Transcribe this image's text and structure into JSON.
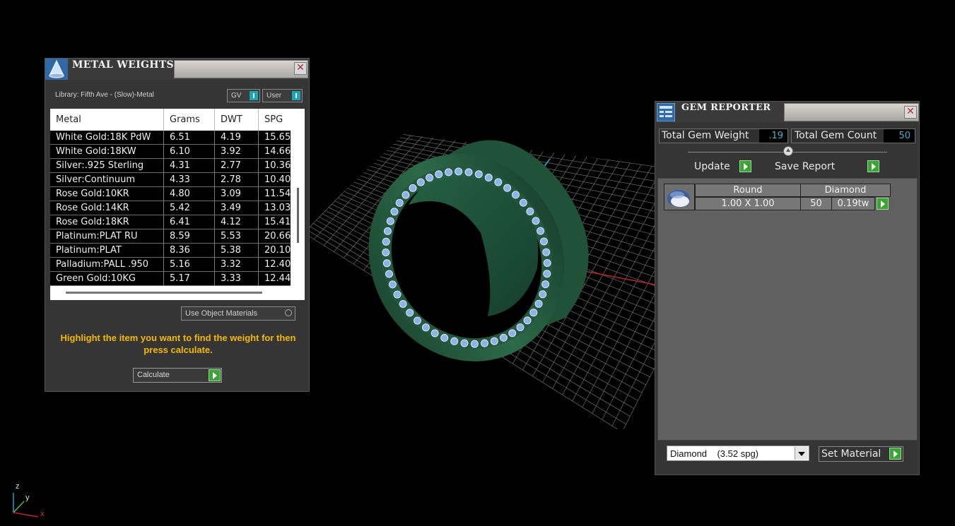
{
  "metal_weights": {
    "title": "METAL WEIGHTS",
    "library_label": "Library: Fifth Ave - (Slow)-Metal",
    "toggle_gv": "GV",
    "toggle_user": "User",
    "columns": [
      "Metal",
      "Grams",
      "DWT",
      "SPG"
    ],
    "rows": [
      [
        "White Gold:18K PdW",
        "6.51",
        "4.19",
        "15.65"
      ],
      [
        "White Gold:18KW",
        "6.10",
        "3.92",
        "14.66"
      ],
      [
        "Silver:.925 Sterling",
        "4.31",
        "2.77",
        "10.36"
      ],
      [
        "Silver:Continuum",
        "4.33",
        "2.78",
        "10.40"
      ],
      [
        "Rose Gold:10KR",
        "4.80",
        "3.09",
        "11.54"
      ],
      [
        "Rose Gold:14KR",
        "5.42",
        "3.49",
        "13.03"
      ],
      [
        "Rose Gold:18KR",
        "6.41",
        "4.12",
        "15.41"
      ],
      [
        "Platinum:PLAT RU",
        "8.59",
        "5.53",
        "20.66"
      ],
      [
        "Platinum:PLAT",
        "8.36",
        "5.38",
        "20.10"
      ],
      [
        "Palladium:PALL .950",
        "5.16",
        "3.32",
        "12.40"
      ],
      [
        "Green Gold:10KG",
        "5.17",
        "3.33",
        "12.44"
      ]
    ],
    "use_object_materials": "Use Object Materials",
    "hint": "Highlight the item you want to find the weight for then press calculate.",
    "calculate_label": "Calculate"
  },
  "gem_reporter": {
    "title": "GEM REPORTER",
    "total_weight_label": "Total Gem Weight",
    "total_weight_value": ".19",
    "total_count_label": "Total Gem Count",
    "total_count_value": "50",
    "update_label": "Update",
    "save_report_label": "Save Report",
    "gem": {
      "shape": "Round",
      "material": "Diamond",
      "size": "1.00 X 1.00",
      "count": "50",
      "weight": "0.19tw"
    },
    "material_select": "Diamond    (3.52 spg)",
    "set_material_label": "Set Material"
  },
  "viewport": {
    "axis_z": "z",
    "axis_y": "y",
    "axis_x": "x"
  }
}
